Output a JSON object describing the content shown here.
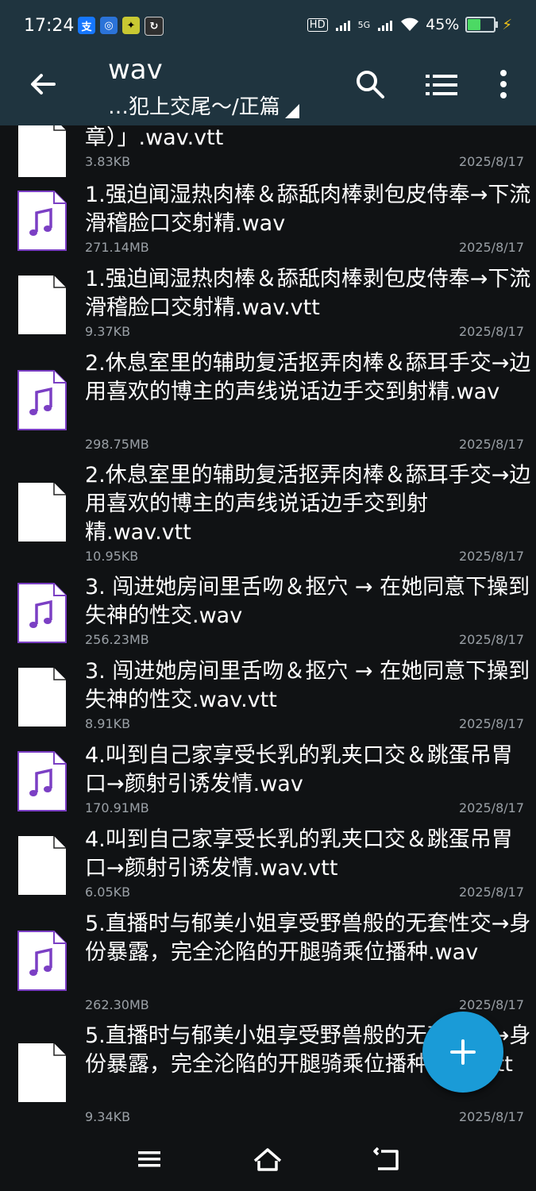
{
  "status_bar": {
    "time": "17:24",
    "battery": "45%",
    "battery_level": 0.45,
    "network_labels": [
      "HD",
      "5G"
    ]
  },
  "app_bar": {
    "title": "wav",
    "path": "…犯上交尾～/正篇"
  },
  "files": [
    {
      "name": "章）」.wav.vtt",
      "size": "3.83KB",
      "date": "2025/8/17",
      "type": "document"
    },
    {
      "name": "1.强迫闻湿热肉棒＆舔舐肉棒剥包皮侍奉→下流滑稽脸口交射精.wav",
      "size": "271.14MB",
      "date": "2025/8/17",
      "type": "audio"
    },
    {
      "name": "1.强迫闻湿热肉棒＆舔舐肉棒剥包皮侍奉→下流滑稽脸口交射精.wav.vtt",
      "size": "9.37KB",
      "date": "2025/8/17",
      "type": "document"
    },
    {
      "name": "2.休息室里的辅助复活抠弄肉棒＆舔耳手交→边用喜欢的博主的声线说话边手交到射精.wav",
      "size": "298.75MB",
      "date": "2025/8/17",
      "type": "audio"
    },
    {
      "name": "2.休息室里的辅助复活抠弄肉棒＆舔耳手交→边用喜欢的博主的声线说话边手交到射精.wav.vtt",
      "size": "10.95KB",
      "date": "2025/8/17",
      "type": "document"
    },
    {
      "name": "3. 闯进她房间里舌吻＆抠穴 → 在她同意下操到失神的性交.wav",
      "size": "256.23MB",
      "date": "2025/8/17",
      "type": "audio"
    },
    {
      "name": "3. 闯进她房间里舌吻＆抠穴 → 在她同意下操到失神的性交.wav.vtt",
      "size": "8.91KB",
      "date": "2025/8/17",
      "type": "document"
    },
    {
      "name": "4.叫到自己家享受长乳的乳夹口交＆跳蛋吊胃口→颜射引诱发情.wav",
      "size": "170.91MB",
      "date": "2025/8/17",
      "type": "audio"
    },
    {
      "name": "4.叫到自己家享受长乳的乳夹口交＆跳蛋吊胃口→颜射引诱发情.wav.vtt",
      "size": "6.05KB",
      "date": "2025/8/17",
      "type": "document"
    },
    {
      "name": "5.直播时与郁美小姐享受野兽般的无套性交→身份暴露，完全沦陷的开腿骑乘位播种.wav",
      "size": "262.30MB",
      "date": "2025/8/17",
      "type": "audio"
    },
    {
      "name": "5.直播时与郁美小姐享受野兽般的无套性交→身份暴露，完全沦陷的开腿骑乘位播种.wav.vtt",
      "size": "9.34KB",
      "date": "2025/8/17",
      "type": "document"
    }
  ],
  "icons": {
    "back": "arrow-left-icon",
    "search": "search-icon",
    "list_view": "list-view-icon",
    "more": "more-vert-icon",
    "fab": "plus-icon",
    "audio_file": "music-file-icon",
    "document_file": "document-file-icon"
  },
  "colors": {
    "app_bar": "#1f343f",
    "background": "#101214",
    "accent_fab": "#1a9bd7",
    "audio_icon_border": "#7b3fc4"
  }
}
